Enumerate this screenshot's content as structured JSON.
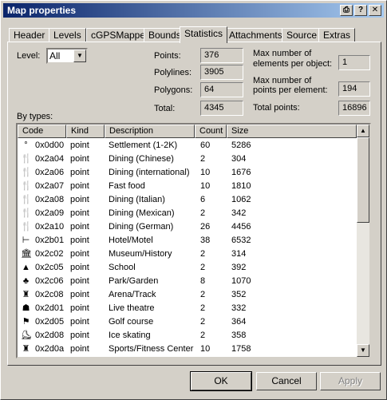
{
  "window": {
    "title": "Map properties"
  },
  "tabs": [
    "Header",
    "Levels",
    "cGPSMapper",
    "Bounds",
    "Statistics",
    "Attachments",
    "Source",
    "Extras"
  ],
  "level": {
    "label": "Level:",
    "value": "All"
  },
  "stats": {
    "points_label": "Points:",
    "points": "376",
    "polylines_label": "Polylines:",
    "polylines": "3905",
    "polygons_label": "Polygons:",
    "polygons": "64",
    "total_label": "Total:",
    "total": "4345",
    "max_elements_label_1": "Max number of",
    "max_elements_label_2": "elements per object:",
    "max_elements": "1",
    "max_points_label_1": "Max number of",
    "max_points_label_2": "points per element:",
    "max_points": "194",
    "total_points_label": "Total points:",
    "total_points": "16896"
  },
  "by_types_label": "By types:",
  "columns": [
    "Code",
    "Kind",
    "Description",
    "Count",
    "Size"
  ],
  "rows": [
    {
      "icon": "dot-icon",
      "glyph": "°",
      "code": "0x0d00",
      "kind": "point",
      "desc": "Settlement (1-2K)",
      "count": "60",
      "size": "5286"
    },
    {
      "icon": "fork-knife-icon",
      "glyph": "🍴",
      "code": "0x2a04",
      "kind": "point",
      "desc": "Dining (Chinese)",
      "count": "2",
      "size": "304"
    },
    {
      "icon": "fork-knife-icon",
      "glyph": "🍴",
      "code": "0x2a06",
      "kind": "point",
      "desc": "Dining (international)",
      "count": "10",
      "size": "1676"
    },
    {
      "icon": "fork-knife-icon",
      "glyph": "🍴",
      "code": "0x2a07",
      "kind": "point",
      "desc": "Fast food",
      "count": "10",
      "size": "1810"
    },
    {
      "icon": "fork-knife-icon",
      "glyph": "🍴",
      "code": "0x2a08",
      "kind": "point",
      "desc": "Dining (Italian)",
      "count": "6",
      "size": "1062"
    },
    {
      "icon": "fork-knife-icon",
      "glyph": "🍴",
      "code": "0x2a09",
      "kind": "point",
      "desc": "Dining (Mexican)",
      "count": "2",
      "size": "342"
    },
    {
      "icon": "fork-knife-icon",
      "glyph": "🍴",
      "code": "0x2a10",
      "kind": "point",
      "desc": "Dining (German)",
      "count": "26",
      "size": "4456"
    },
    {
      "icon": "bed-icon",
      "glyph": "⊢",
      "code": "0x2b01",
      "kind": "point",
      "desc": "Hotel/Motel",
      "count": "38",
      "size": "6532"
    },
    {
      "icon": "museum-icon",
      "glyph": "🏛",
      "code": "0x2c02",
      "kind": "point",
      "desc": "Museum/History",
      "count": "2",
      "size": "314"
    },
    {
      "icon": "school-icon",
      "glyph": "▲",
      "code": "0x2c05",
      "kind": "point",
      "desc": "School",
      "count": "2",
      "size": "392"
    },
    {
      "icon": "tree-icon",
      "glyph": "♣",
      "code": "0x2c06",
      "kind": "point",
      "desc": "Park/Garden",
      "count": "8",
      "size": "1070"
    },
    {
      "icon": "trophy-icon",
      "glyph": "♜",
      "code": "0x2c08",
      "kind": "point",
      "desc": "Arena/Track",
      "count": "2",
      "size": "352"
    },
    {
      "icon": "theatre-icon",
      "glyph": "☗",
      "code": "0x2d01",
      "kind": "point",
      "desc": "Live theatre",
      "count": "2",
      "size": "332"
    },
    {
      "icon": "golf-icon",
      "glyph": "⚑",
      "code": "0x2d05",
      "kind": "point",
      "desc": "Golf course",
      "count": "2",
      "size": "364"
    },
    {
      "icon": "skate-icon",
      "glyph": "⛸",
      "code": "0x2d08",
      "kind": "point",
      "desc": "Ice skating",
      "count": "2",
      "size": "358"
    },
    {
      "icon": "trophy-icon",
      "glyph": "♜",
      "code": "0x2d0a",
      "kind": "point",
      "desc": "Sports/Fitness Center",
      "count": "10",
      "size": "1758"
    }
  ],
  "buttons": {
    "ok": "OK",
    "cancel": "Cancel",
    "apply": "Apply"
  },
  "colors": {
    "title_start": "#0a246a",
    "title_end": "#a6caf0",
    "face": "#d4d0c8"
  }
}
